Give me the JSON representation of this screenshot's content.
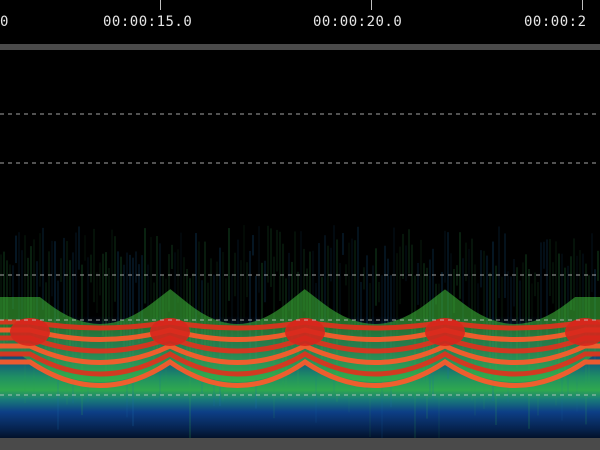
{
  "timeline": {
    "ticks": [
      {
        "label": "0"
      },
      {
        "label": "00:00:15.0"
      },
      {
        "label": "00:00:20.0"
      },
      {
        "label": "00:00:2"
      }
    ]
  },
  "colors": {
    "background": "#000000",
    "ruler_separator": "#4a4a4a",
    "gridline": "#cfcfcf",
    "heat_low": "#0b2f6b",
    "heat_mid": "#2fa84f",
    "heat_high": "#e0321d"
  }
}
